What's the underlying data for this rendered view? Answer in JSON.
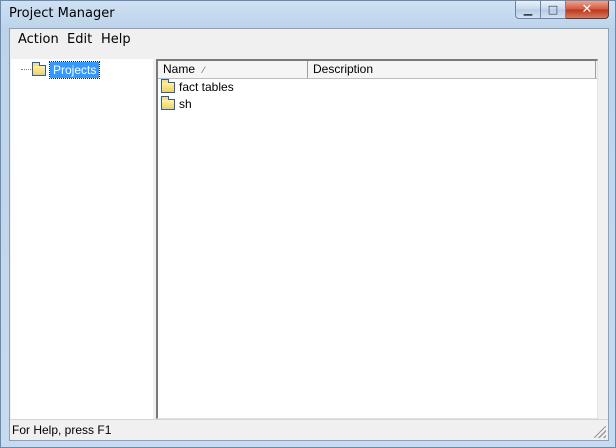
{
  "window": {
    "title": "Project Manager",
    "minimize_symbol": "▁",
    "maximize_symbol": "□",
    "close_symbol": "✕"
  },
  "menubar": {
    "items": [
      "Action",
      "Edit",
      "Help"
    ]
  },
  "tree": {
    "root": {
      "label": "Projects",
      "icon": "folder-icon",
      "selected": true
    }
  },
  "list": {
    "columns": [
      {
        "label": "Name",
        "sort_indicator": "⁄"
      },
      {
        "label": "Description"
      }
    ],
    "rows": [
      {
        "name": "fact tables",
        "description": "",
        "icon": "folder-icon"
      },
      {
        "name": "sh",
        "description": "",
        "icon": "folder-icon"
      }
    ]
  },
  "statusbar": {
    "text": "For Help, press F1"
  },
  "colors": {
    "selection": "#3399ff",
    "title_close": "#c8472b"
  }
}
